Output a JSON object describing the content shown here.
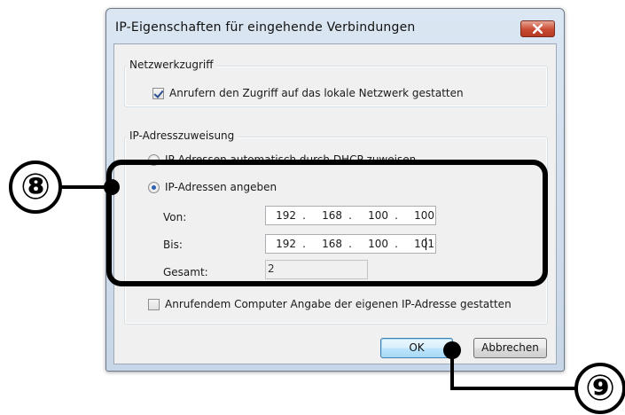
{
  "window": {
    "title": "IP-Eigenschaften für eingehende Verbindungen"
  },
  "network_access": {
    "group_title": "Netzwerkzugriff",
    "allow_lan_label": "Anrufern den Zugriff auf das lokale Netzwerk gestatten",
    "allow_lan_checked": true
  },
  "ip_assignment": {
    "group_title": "IP-Adresszuweisung",
    "dhcp_label": "IP-Adressen automatisch durch DHCP zuweisen",
    "specify_label": "IP-Adressen angeben",
    "selected": "specify",
    "from_label": "Von:",
    "from_ip": [
      "192",
      "168",
      "100",
      "100"
    ],
    "to_label": "Bis:",
    "to_ip": [
      "192",
      "168",
      "100",
      "101"
    ],
    "total_label": "Gesamt:",
    "total_value": "2",
    "ip_separator": "."
  },
  "caller_ip": {
    "label": "Anrufendem Computer Angabe der eigenen IP-Adresse gestatten",
    "checked": false
  },
  "buttons": {
    "ok": "OK",
    "cancel": "Abbrechen"
  },
  "annotations": {
    "step8": "⑧",
    "step9": "⑨"
  }
}
